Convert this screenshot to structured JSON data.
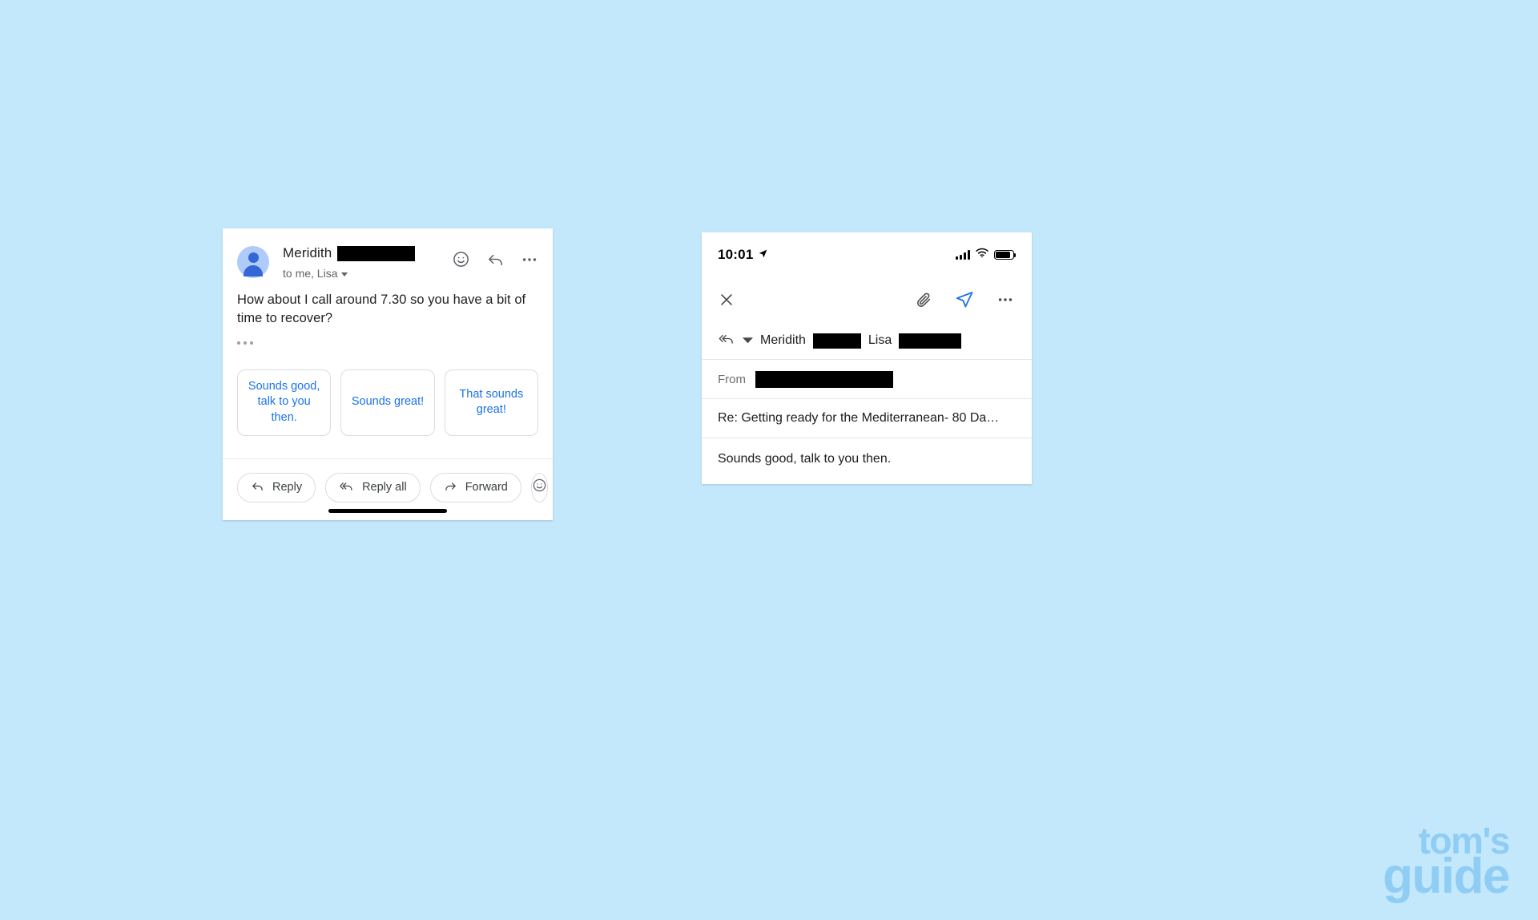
{
  "background_color": "#c3e7fb",
  "gmail_card": {
    "sender_name": "Meridith",
    "sender_redacted": true,
    "recipients": "to me, Lisa",
    "message_text": "How about I call around 7.30 so you have a bit of time to recover?",
    "header_icons": [
      "emoji-icon",
      "reply-icon",
      "more-options-icon"
    ],
    "expand_ellipsis": "•••",
    "smart_replies": [
      "Sounds good, talk to you then.",
      "Sounds great!",
      "That sounds great!"
    ],
    "smart_reply_color": "#1a73e8",
    "actions": [
      {
        "label": "Reply",
        "icon": "reply-arrow-icon"
      },
      {
        "label": "Reply all",
        "icon": "reply-all-arrow-icon"
      },
      {
        "label": "Forward",
        "icon": "forward-arrow-icon"
      }
    ],
    "emoji_action_icon": "emoji-smiley-icon"
  },
  "ios_card": {
    "status_bar": {
      "time": "10:01",
      "location_icon": "location-arrow-icon",
      "signal_icon": "cellular-signal-icon",
      "wifi_icon": "wifi-icon",
      "battery_icon": "battery-icon"
    },
    "toolbar": {
      "close_icon": "close-x-icon",
      "attach_icon": "paperclip-icon",
      "send_icon": "send-paper-plane-icon",
      "more_icon": "more-options-icon",
      "send_color": "#1a73e8"
    },
    "recipients_row": {
      "reply_all_icon": "reply-all-icon",
      "dropdown_icon": "chevron-down-icon",
      "name_1": "Meridith",
      "name_1_redacted": true,
      "name_2": "Lisa",
      "name_2_redacted": true
    },
    "from_row": {
      "label": "From",
      "value_redacted": true
    },
    "subject": "Re: Getting ready for the Mediterranean- 80 Da…",
    "body": "Sounds good, talk to you then."
  },
  "watermark": {
    "line1": "tom's",
    "line2": "guide",
    "color": "#8fcdf4"
  }
}
